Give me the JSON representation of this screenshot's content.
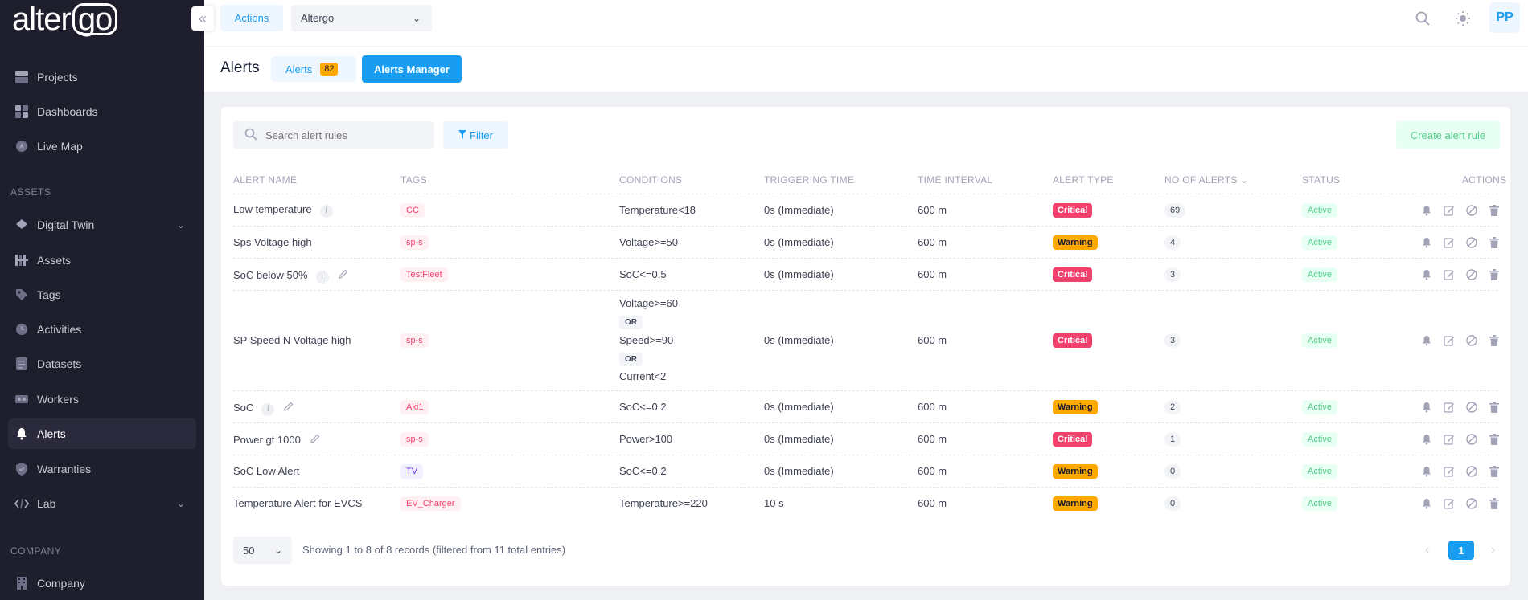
{
  "brand": {
    "logo_prefix": "alter",
    "logo_box": "go"
  },
  "sidebar": {
    "items": [
      {
        "label": "Projects",
        "icon": "projects-icon"
      },
      {
        "label": "Dashboards",
        "icon": "dashboards-icon"
      },
      {
        "label": "Live Map",
        "icon": "live-map-icon"
      },
      {
        "label": "Digital Twin",
        "icon": "digital-twin-icon"
      },
      {
        "label": "Assets",
        "icon": "assets-icon"
      },
      {
        "label": "Tags",
        "icon": "tag-icon"
      },
      {
        "label": "Activities",
        "icon": "activities-icon"
      },
      {
        "label": "Datasets",
        "icon": "datasets-icon"
      },
      {
        "label": "Workers",
        "icon": "workers-icon"
      },
      {
        "label": "Alerts",
        "icon": "bell-icon",
        "active": true
      },
      {
        "label": "Warranties",
        "icon": "shield-icon"
      },
      {
        "label": "Lab",
        "icon": "code-icon"
      },
      {
        "label": "Company",
        "icon": "building-icon"
      }
    ],
    "sections": {
      "assets": "ASSETS",
      "company": "COMPANY"
    }
  },
  "topbar": {
    "actions_label": "Actions",
    "org_selected": "Altergo",
    "avatar_initials": "PP"
  },
  "subbar": {
    "title": "Alerts",
    "tab_alerts": "Alerts",
    "alerts_count": "82",
    "tab_manager": "Alerts Manager"
  },
  "toolbar": {
    "search_placeholder": "Search alert rules",
    "filter_label": "Filter",
    "create_label": "Create alert rule"
  },
  "table": {
    "headers": {
      "name": "ALERT NAME",
      "tags": "TAGS",
      "conditions": "CONDITIONS",
      "triggering": "TRIGGERING TIME",
      "interval": "TIME INTERVAL",
      "type": "ALERT TYPE",
      "count": "NO OF ALERTS",
      "status": "STATUS",
      "actions": "ACTIONS"
    },
    "rows": [
      {
        "name": "Low temperature",
        "tag": "CC",
        "conditions": [
          "Temperature<18"
        ],
        "triggering": "0s (Immediate)",
        "interval": "600 m",
        "type": "Critical",
        "count": "69",
        "status": "Active"
      },
      {
        "name": "Sps Voltage high",
        "tag": "sp-s",
        "conditions": [
          "Voltage>=50"
        ],
        "triggering": "0s (Immediate)",
        "interval": "600 m",
        "type": "Warning",
        "count": "4",
        "status": "Active"
      },
      {
        "name": "SoC below 50%",
        "tag": "TestFleet",
        "conditions": [
          "SoC<=0.5"
        ],
        "triggering": "0s (Immediate)",
        "interval": "600 m",
        "type": "Critical",
        "count": "3",
        "status": "Active"
      },
      {
        "name": "SP Speed N Voltage high",
        "tag": "sp-s",
        "conditions": [
          "Voltage>=60",
          "OR",
          "Speed>=90",
          "OR",
          "Current<2"
        ],
        "triggering": "0s (Immediate)",
        "interval": "600 m",
        "type": "Critical",
        "count": "3",
        "status": "Active"
      },
      {
        "name": "SoC",
        "tag": "Aki1",
        "conditions": [
          "SoC<=0.2"
        ],
        "triggering": "0s (Immediate)",
        "interval": "600 m",
        "type": "Warning",
        "count": "2",
        "status": "Active"
      },
      {
        "name": "Power gt 1000",
        "tag": "sp-s",
        "conditions": [
          "Power>100"
        ],
        "triggering": "0s (Immediate)",
        "interval": "600 m",
        "type": "Critical",
        "count": "1",
        "status": "Active"
      },
      {
        "name": "SoC Low Alert",
        "tag": "TV",
        "conditions": [
          "SoC<=0.2"
        ],
        "triggering": "0s (Immediate)",
        "interval": "600 m",
        "type": "Warning",
        "count": "0",
        "status": "Active"
      },
      {
        "name": "Temperature Alert for EVCS",
        "tag": "EV_Charger",
        "conditions": [
          "Temperature>=220"
        ],
        "triggering": "10 s",
        "interval": "600 m",
        "type": "Warning",
        "count": "0",
        "status": "Active"
      }
    ]
  },
  "footer": {
    "page_size": "50",
    "records_text": "Showing 1 to 8 of 8 records (filtered from 11 total entries)",
    "current_page": "1"
  },
  "colors": {
    "accent": "#1a9cf0",
    "critical": "#f1416c",
    "warning": "#ffa800",
    "active": "#50cd89",
    "sidebar_bg": "#1e1e2d"
  }
}
